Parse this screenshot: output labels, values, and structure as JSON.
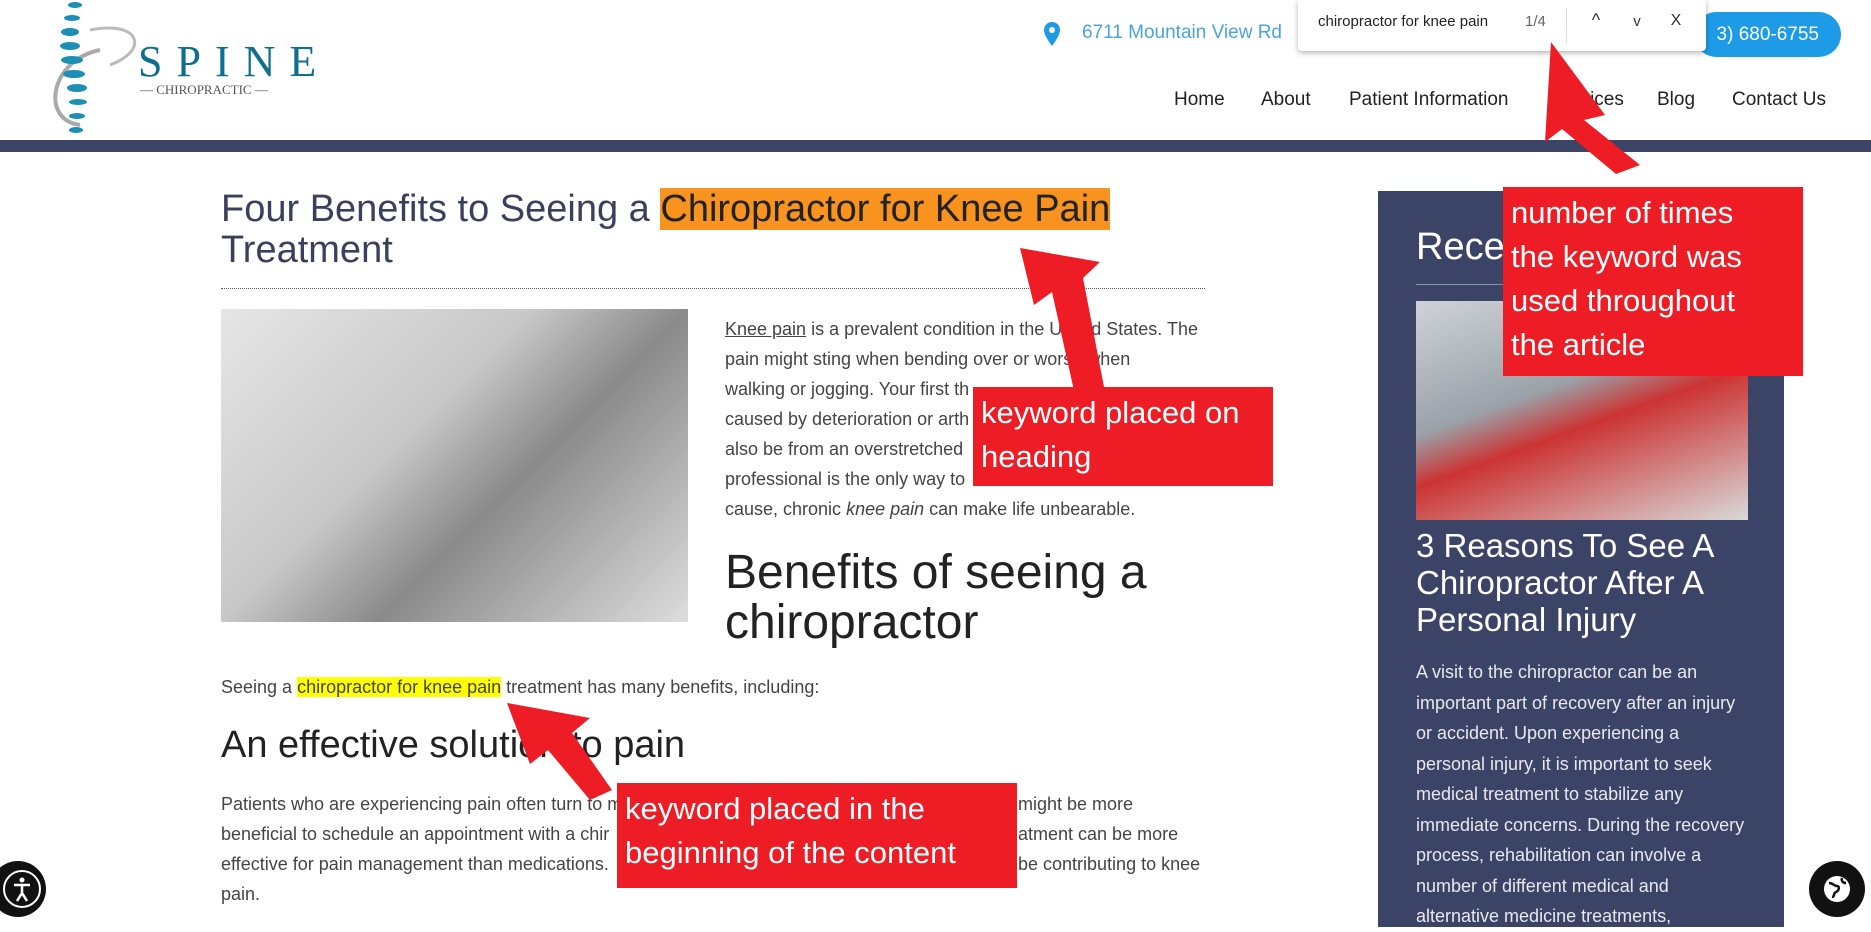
{
  "header": {
    "logo": {
      "name": "SPINE",
      "sub": "CHIROPRACTIC"
    },
    "address": "6711 Mountain View Rd",
    "phone": "3) 680-6755",
    "nav": [
      "Home",
      "About",
      "Patient Information",
      "Services",
      "Blog",
      "Contact Us"
    ]
  },
  "find_bar": {
    "query": "chiropractor for knee pain",
    "count": "1/4",
    "prev": "^",
    "next": "v",
    "close": "X"
  },
  "article": {
    "title_before": "Four Benefits to Seeing a ",
    "title_keyword": "Chiropractor for Knee Pain",
    "title_after": "Treatment",
    "intro_link": "Knee pain",
    "intro_lines": [
      " is a prevalent condition in the United States. The",
      "pain might sting when bending over or worse when",
      "walking or jogging. Your first th",
      "caused by deterioration or arth",
      "also be from an overstretched",
      "professional is the only way to "
    ],
    "intro_last_a": "cause, chronic ",
    "intro_last_em": "knee pain",
    "intro_last_b": " can make life unbearable.",
    "h2": "Benefits of seeing a chiropractor",
    "seeing_a": "Seeing a ",
    "seeing_kw": "chiropractor for knee pain",
    "seeing_rest": " treatment has many benefits, including:",
    "h3": "An effective solution to pain",
    "para_lines": [
      {
        "a": "Patients who are experiencing pain often turn to m",
        "b": "might be more"
      },
      {
        "a": "beneficial to schedule an appointment with a chir",
        "b": "atment can be more"
      },
      {
        "a": "effective for pain management than medications.",
        "b": "be contributing to knee"
      },
      {
        "a": "pain.",
        "b": ""
      }
    ]
  },
  "sidebar": {
    "heading": "Rece",
    "post_title": "3 Reasons To See A Chiropractor After A Personal Injury",
    "post_lines": [
      "A visit to the chiropractor can be an",
      "important part of recovery after an injury",
      "or accident. Upon experiencing a",
      "personal injury, it is important to seek",
      "medical treatment to stabilize any",
      "immediate concerns. During the recovery",
      "process, rehabilitation can involve a",
      "number of different medical and",
      "alternative medicine treatments,"
    ]
  },
  "annotations": [
    {
      "text": "number of times the keyword was used throughout the article",
      "lines": [
        "number of times",
        "the keyword was",
        "used throughout",
        "the article"
      ]
    },
    {
      "lines": [
        "keyword placed on",
        "heading"
      ]
    },
    {
      "lines": [
        "keyword placed in the",
        "beginning of the content"
      ]
    }
  ],
  "colors": {
    "brand_navy": "#3b4466",
    "phone_blue": "#1e9be6",
    "annotation_red": "#ee1c25",
    "highlight_current": "#f7931e",
    "highlight": "#ffff00"
  },
  "icons": {
    "address": "map-pin-icon",
    "bottom_left": "accessibility-icon",
    "bottom_right": "globe-icon"
  }
}
